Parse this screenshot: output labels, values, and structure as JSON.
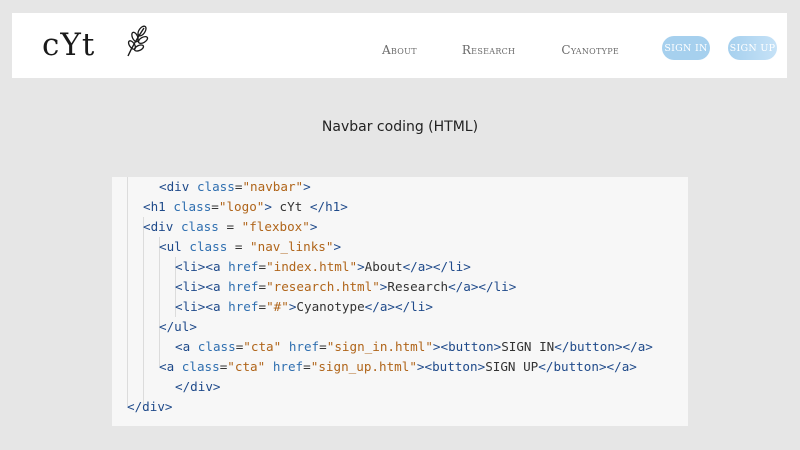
{
  "navbar": {
    "logo": "cYt",
    "links": [
      "About",
      "Research",
      "Cyanotype"
    ],
    "signin": "SIGN IN",
    "signup": "SIGN UP"
  },
  "caption": "Navbar coding (HTML)",
  "code": {
    "lines": [
      [
        [
          "t",
          "<"
        ],
        [
          "t",
          "div"
        ],
        [
          "s",
          " "
        ],
        [
          "a",
          "class"
        ],
        [
          "s",
          "="
        ],
        [
          "v",
          "\"navbar\""
        ],
        [
          "t",
          ">"
        ]
      ],
      [
        [
          "t",
          "<"
        ],
        [
          "t",
          "h1"
        ],
        [
          "s",
          " "
        ],
        [
          "a",
          "class"
        ],
        [
          "s",
          "="
        ],
        [
          "v",
          "\"logo\""
        ],
        [
          "t",
          ">"
        ],
        [
          "s",
          " cYt "
        ],
        [
          "t",
          "</"
        ],
        [
          "t",
          "h1"
        ],
        [
          "t",
          ">"
        ]
      ],
      [
        [
          "t",
          "<"
        ],
        [
          "t",
          "div"
        ],
        [
          "s",
          " "
        ],
        [
          "a",
          "class"
        ],
        [
          "s",
          " = "
        ],
        [
          "v",
          "\"flexbox\""
        ],
        [
          "t",
          ">"
        ]
      ],
      [
        [
          "t",
          "<"
        ],
        [
          "t",
          "ul"
        ],
        [
          "s",
          " "
        ],
        [
          "a",
          "class"
        ],
        [
          "s",
          " = "
        ],
        [
          "v",
          "\"nav_links\""
        ],
        [
          "t",
          ">"
        ]
      ],
      [
        [
          "t",
          "<"
        ],
        [
          "t",
          "li"
        ],
        [
          "t",
          "><"
        ],
        [
          "t",
          "a"
        ],
        [
          "s",
          " "
        ],
        [
          "a",
          "href"
        ],
        [
          "s",
          "="
        ],
        [
          "v",
          "\"index.html\""
        ],
        [
          "t",
          ">"
        ],
        [
          "s",
          "About"
        ],
        [
          "t",
          "</"
        ],
        [
          "t",
          "a"
        ],
        [
          "t",
          "></"
        ],
        [
          "t",
          "li"
        ],
        [
          "t",
          ">"
        ]
      ],
      [
        [
          "t",
          "<"
        ],
        [
          "t",
          "li"
        ],
        [
          "t",
          "><"
        ],
        [
          "t",
          "a"
        ],
        [
          "s",
          " "
        ],
        [
          "a",
          "href"
        ],
        [
          "s",
          "="
        ],
        [
          "v",
          "\"research.html\""
        ],
        [
          "t",
          ">"
        ],
        [
          "s",
          "Research"
        ],
        [
          "t",
          "</"
        ],
        [
          "t",
          "a"
        ],
        [
          "t",
          "></"
        ],
        [
          "t",
          "li"
        ],
        [
          "t",
          ">"
        ]
      ],
      [
        [
          "t",
          "<"
        ],
        [
          "t",
          "li"
        ],
        [
          "t",
          "><"
        ],
        [
          "t",
          "a"
        ],
        [
          "s",
          " "
        ],
        [
          "a",
          "href"
        ],
        [
          "s",
          "="
        ],
        [
          "v",
          "\"#\""
        ],
        [
          "t",
          ">"
        ],
        [
          "s",
          "Cyanotype"
        ],
        [
          "t",
          "</"
        ],
        [
          "t",
          "a"
        ],
        [
          "t",
          "></"
        ],
        [
          "t",
          "li"
        ],
        [
          "t",
          ">"
        ]
      ],
      [
        [
          "t",
          "</"
        ],
        [
          "t",
          "ul"
        ],
        [
          "t",
          ">"
        ]
      ],
      [
        [
          "t",
          "<"
        ],
        [
          "t",
          "a"
        ],
        [
          "s",
          " "
        ],
        [
          "a",
          "class"
        ],
        [
          "s",
          "="
        ],
        [
          "v",
          "\"cta\""
        ],
        [
          "s",
          " "
        ],
        [
          "a",
          "href"
        ],
        [
          "s",
          "="
        ],
        [
          "v",
          "\"sign_in.html\""
        ],
        [
          "t",
          ">"
        ],
        [
          "t",
          "<"
        ],
        [
          "t",
          "button"
        ],
        [
          "t",
          ">"
        ],
        [
          "s",
          "SIGN IN"
        ],
        [
          "t",
          "</"
        ],
        [
          "t",
          "button"
        ],
        [
          "t",
          "></"
        ],
        [
          "t",
          "a"
        ],
        [
          "t",
          ">"
        ]
      ],
      [
        [
          "t",
          "<"
        ],
        [
          "t",
          "a"
        ],
        [
          "s",
          " "
        ],
        [
          "a",
          "class"
        ],
        [
          "s",
          "="
        ],
        [
          "v",
          "\"cta\""
        ],
        [
          "s",
          " "
        ],
        [
          "a",
          "href"
        ],
        [
          "s",
          "="
        ],
        [
          "v",
          "\"sign_up.html\""
        ],
        [
          "t",
          ">"
        ],
        [
          "t",
          "<"
        ],
        [
          "t",
          "button"
        ],
        [
          "t",
          ">"
        ],
        [
          "s",
          "SIGN UP"
        ],
        [
          "t",
          "</"
        ],
        [
          "t",
          "button"
        ],
        [
          "t",
          "></"
        ],
        [
          "t",
          "a"
        ],
        [
          "t",
          ">"
        ]
      ],
      [
        [
          "t",
          "</"
        ],
        [
          "t",
          "div"
        ],
        [
          "t",
          ">"
        ]
      ],
      [
        [
          "t",
          "</"
        ],
        [
          "t",
          "div"
        ],
        [
          "t",
          ">"
        ]
      ]
    ]
  }
}
